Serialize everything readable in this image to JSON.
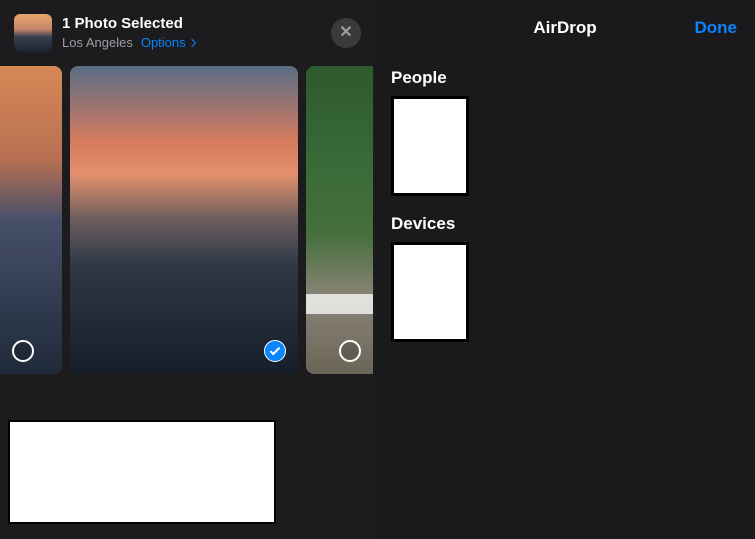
{
  "share": {
    "title": "1 Photo Selected",
    "location": "Los Angeles",
    "options_label": "Options",
    "photos": [
      {
        "selected": false
      },
      {
        "selected": true
      },
      {
        "selected": false
      }
    ]
  },
  "airdrop": {
    "title": "AirDrop",
    "done_label": "Done",
    "sections": {
      "people_label": "People",
      "devices_label": "Devices"
    }
  },
  "colors": {
    "accent": "#0a84ff"
  }
}
